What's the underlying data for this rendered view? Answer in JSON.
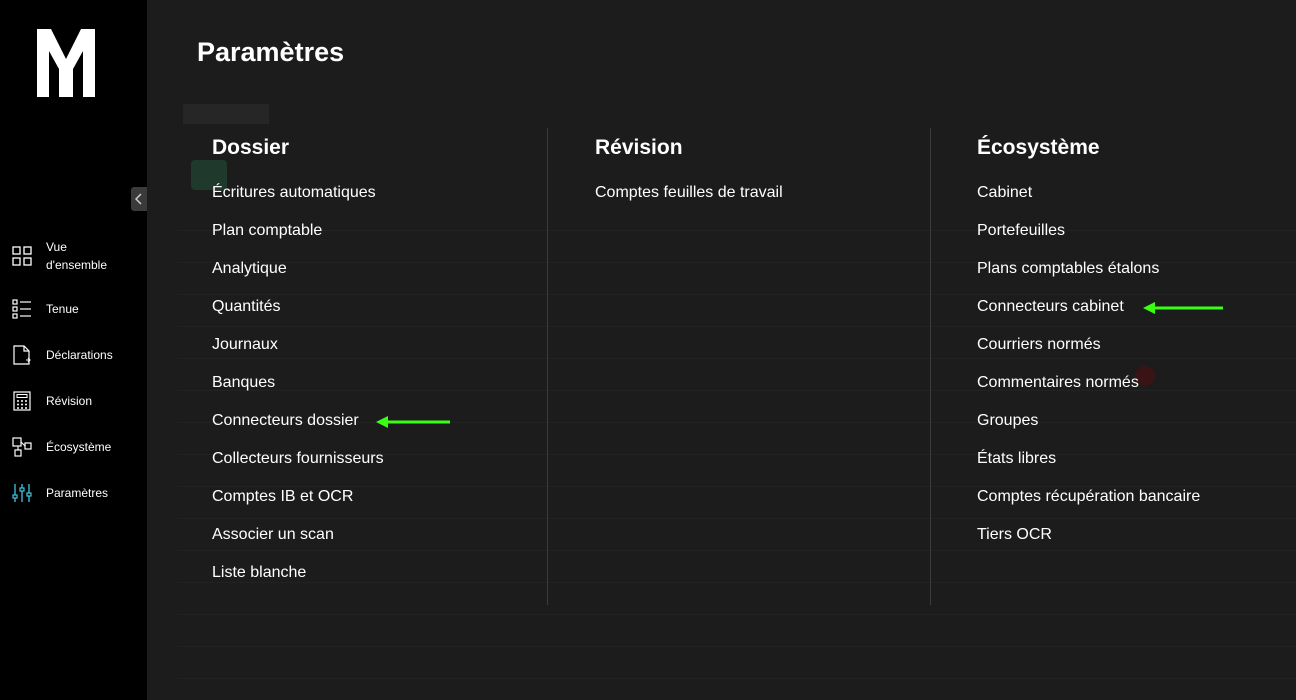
{
  "sidebar": {
    "logo_icon": "logo-m-icon",
    "collapse_icon": "chevron-left-icon",
    "items": [
      {
        "label": "Vue d'ensemble",
        "icon": "grid-icon"
      },
      {
        "label": "Tenue",
        "icon": "list-icon"
      },
      {
        "label": "Déclarations",
        "icon": "document-icon"
      },
      {
        "label": "Révision",
        "icon": "calculator-icon"
      },
      {
        "label": "Écosystème",
        "icon": "network-icon"
      },
      {
        "label": "Paramètres",
        "icon": "sliders-icon",
        "active": true
      }
    ]
  },
  "menu": {
    "title": "Paramètres",
    "columns": [
      {
        "header": "Dossier",
        "items": [
          "Écritures automatiques",
          "Plan comptable",
          "Analytique",
          "Quantités",
          "Journaux",
          "Banques",
          "Connecteurs dossier",
          "Collecteurs fournisseurs",
          "Comptes IB et OCR",
          "Associer un scan",
          "Liste blanche"
        ]
      },
      {
        "header": "Révision",
        "items": [
          "Comptes feuilles de travail"
        ]
      },
      {
        "header": "Écosystème",
        "items": [
          "Cabinet",
          "Portefeuilles",
          "Plans comptables étalons",
          "Connecteurs cabinet",
          "Courriers normés",
          "Commentaires normés",
          "Groupes",
          "États libres",
          "Comptes récupération bancaire",
          "Tiers OCR"
        ]
      }
    ]
  },
  "annotations": {
    "arrow_color": "#39ff14",
    "accent_color": "#3ec6e0"
  }
}
